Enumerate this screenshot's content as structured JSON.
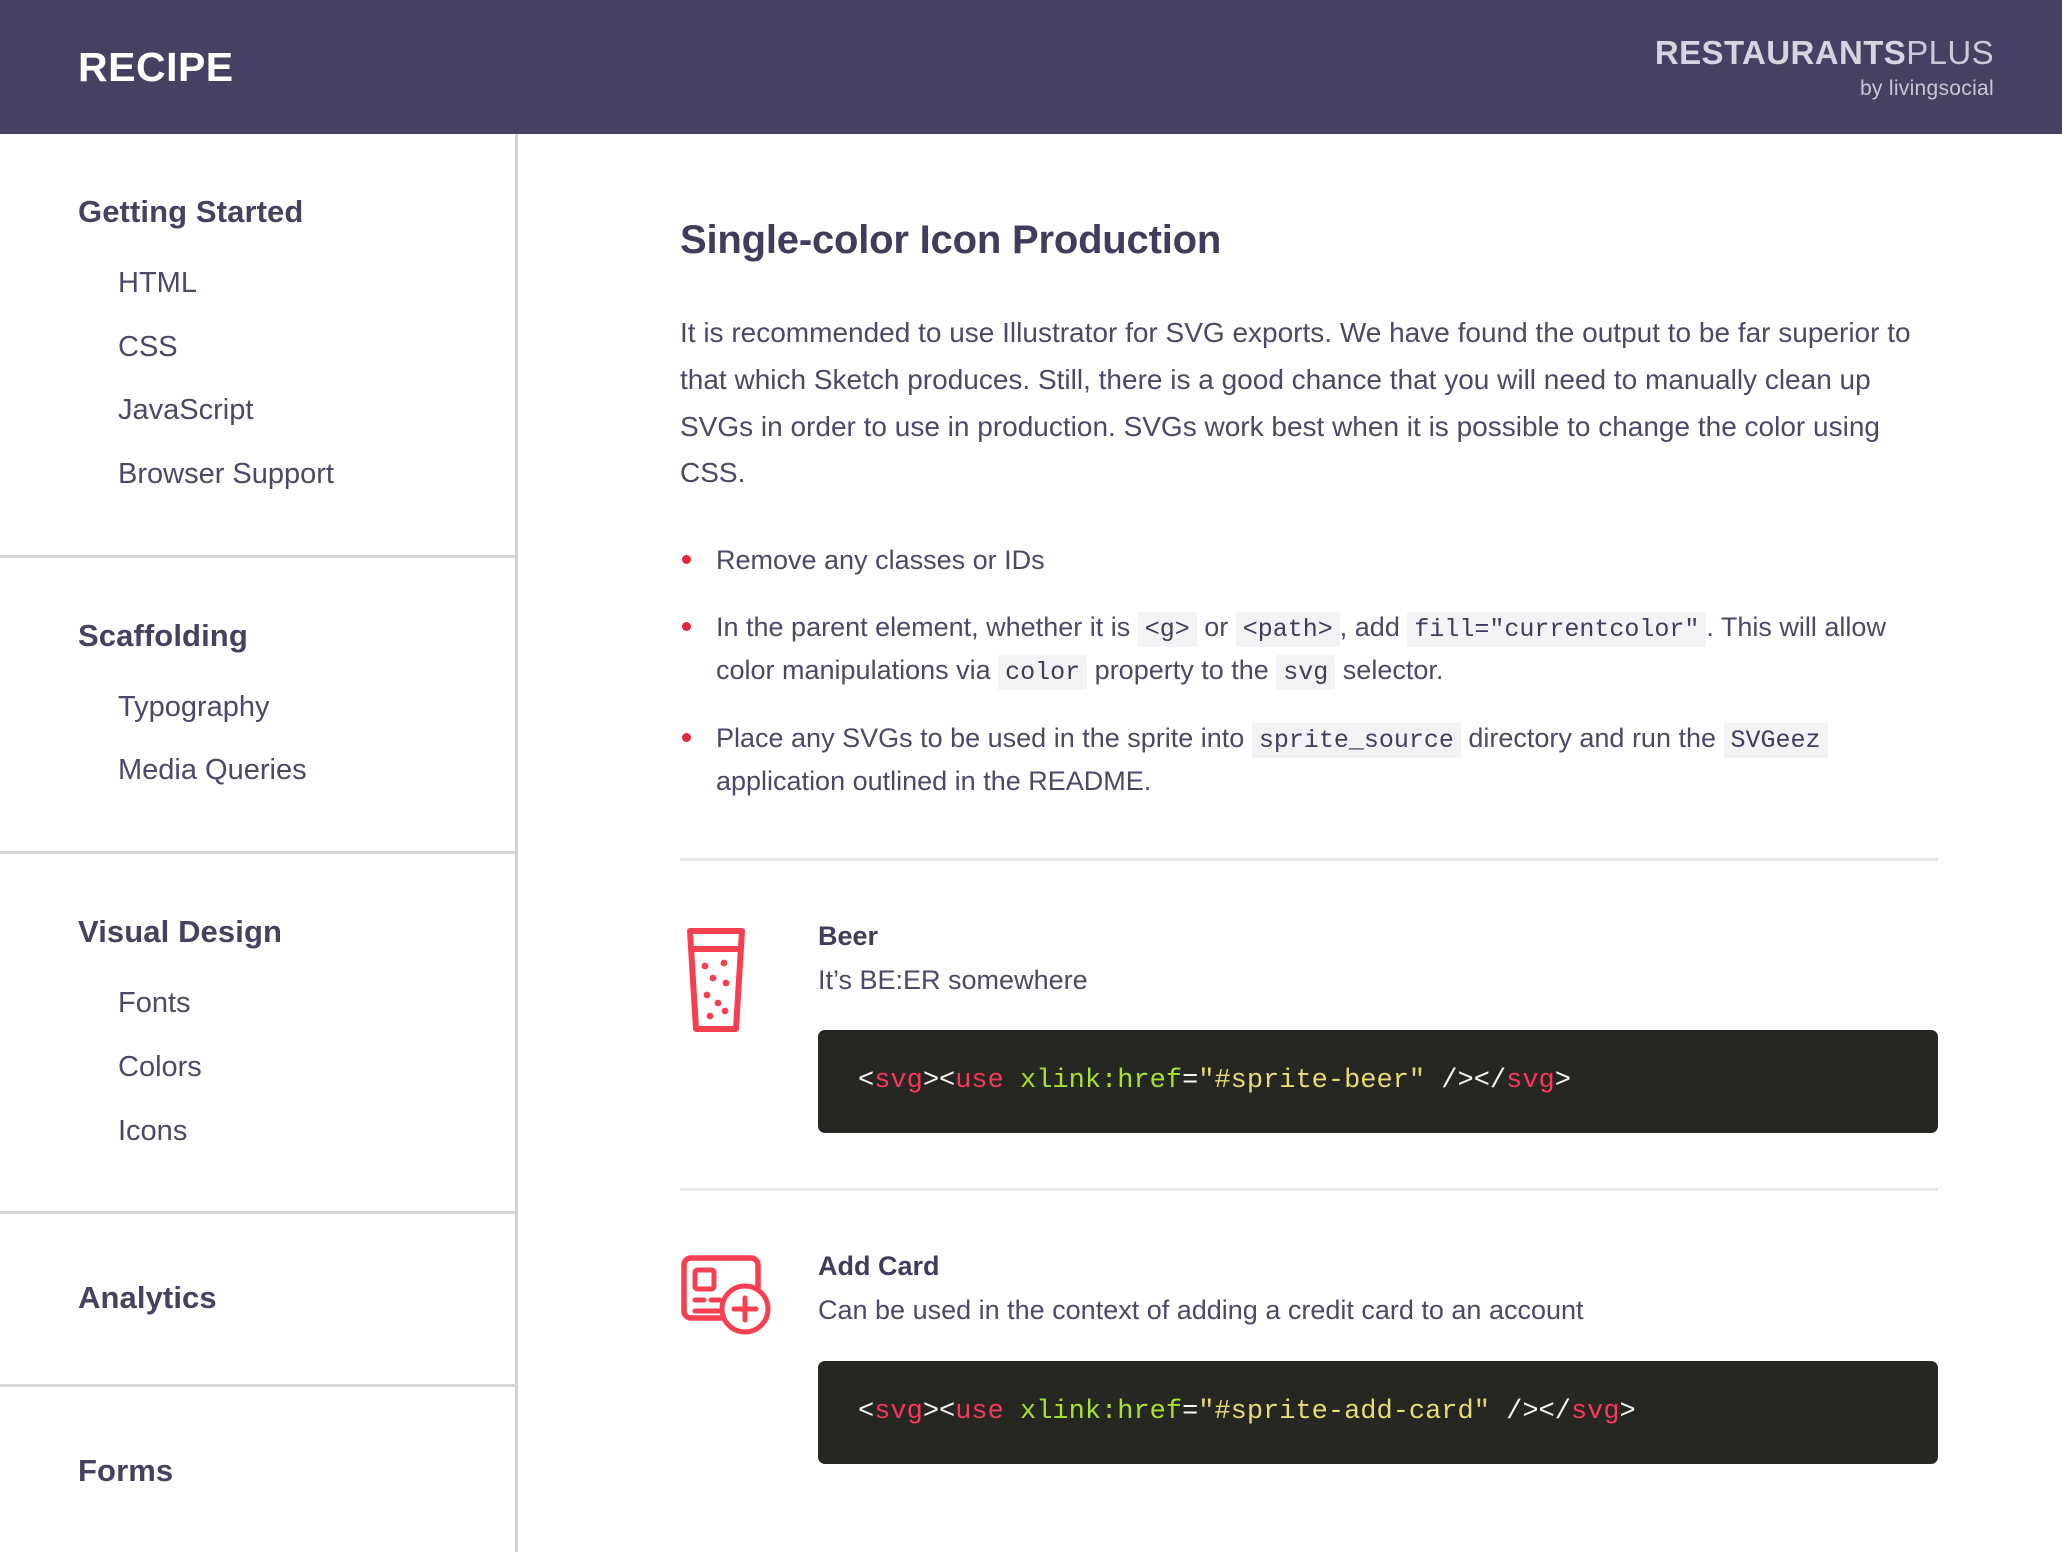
{
  "header": {
    "title": "RECIPE",
    "logo_bold": "RESTAURANTS",
    "logo_light": "PLUS",
    "logo_sub": "by livingsocial"
  },
  "sidebar": {
    "sections": [
      {
        "title": "Getting Started",
        "items": [
          {
            "label": "HTML"
          },
          {
            "label": "CSS"
          },
          {
            "label": "JavaScript"
          },
          {
            "label": "Browser Support"
          }
        ]
      },
      {
        "title": "Scaffolding",
        "items": [
          {
            "label": "Typography"
          },
          {
            "label": "Media Queries"
          }
        ]
      },
      {
        "title": "Visual Design",
        "items": [
          {
            "label": "Fonts"
          },
          {
            "label": "Colors"
          },
          {
            "label": "Icons"
          }
        ]
      },
      {
        "title": "Analytics",
        "items": []
      },
      {
        "title": "Forms",
        "items": []
      }
    ]
  },
  "main": {
    "title": "Single-color Icon Production",
    "intro": "It is recommended to use Illustrator for SVG exports. We have found the output to be far superior to that which Sketch produces. Still, there is a good chance that you will need to manually clean up SVGs in order to use in production. SVGs work best when it is possible to change the color using CSS.",
    "bullets": [
      {
        "parts": [
          {
            "type": "text",
            "value": "Remove any classes or IDs"
          }
        ]
      },
      {
        "parts": [
          {
            "type": "text",
            "value": "In the parent element, whether it is "
          },
          {
            "type": "code",
            "value": "<g>"
          },
          {
            "type": "text",
            "value": " or "
          },
          {
            "type": "code",
            "value": "<path>"
          },
          {
            "type": "text",
            "value": ", add "
          },
          {
            "type": "code",
            "value": "fill=\"currentcolor\""
          },
          {
            "type": "text",
            "value": ". This will allow color manipulations via "
          },
          {
            "type": "code",
            "value": "color"
          },
          {
            "type": "text",
            "value": " property to the "
          },
          {
            "type": "code",
            "value": "svg"
          },
          {
            "type": "text",
            "value": " selector."
          }
        ]
      },
      {
        "parts": [
          {
            "type": "text",
            "value": "Place any SVGs to be used in the sprite into "
          },
          {
            "type": "code",
            "value": "sprite_source"
          },
          {
            "type": "text",
            "value": " directory and run the "
          },
          {
            "type": "code",
            "value": "SVGeez"
          },
          {
            "type": "text",
            "value": " application outlined in the README."
          }
        ]
      }
    ],
    "icons": [
      {
        "icon": "beer-icon",
        "name": "Beer",
        "description": "It’s BE:ER somewhere",
        "snippet": {
          "sprite_id": "#sprite-beer",
          "tokens": [
            {
              "t": "punct",
              "v": "<"
            },
            {
              "t": "tag",
              "v": "svg"
            },
            {
              "t": "punct",
              "v": "><"
            },
            {
              "t": "tag",
              "v": "use"
            },
            {
              "t": "punct",
              "v": " "
            },
            {
              "t": "attr",
              "v": "xlink:href"
            },
            {
              "t": "punct",
              "v": "="
            },
            {
              "t": "str",
              "v": "\"#sprite-beer\""
            },
            {
              "t": "punct",
              "v": " /></"
            },
            {
              "t": "tag",
              "v": "svg"
            },
            {
              "t": "punct",
              "v": ">"
            }
          ]
        }
      },
      {
        "icon": "add-card-icon",
        "name": "Add Card",
        "description": "Can be used in the context of adding a credit card to an account",
        "snippet": {
          "sprite_id": "#sprite-add-card",
          "tokens": [
            {
              "t": "punct",
              "v": "<"
            },
            {
              "t": "tag",
              "v": "svg"
            },
            {
              "t": "punct",
              "v": "><"
            },
            {
              "t": "tag",
              "v": "use"
            },
            {
              "t": "punct",
              "v": " "
            },
            {
              "t": "attr",
              "v": "xlink:href"
            },
            {
              "t": "punct",
              "v": "="
            },
            {
              "t": "str",
              "v": "\"#sprite-add-card\""
            },
            {
              "t": "punct",
              "v": " /></"
            },
            {
              "t": "tag",
              "v": "svg"
            },
            {
              "t": "punct",
              "v": ">"
            }
          ]
        }
      }
    ]
  },
  "colors": {
    "header_bg": "#464162",
    "accent_red": "#f63f51",
    "bullet_red": "#e4253d",
    "text_purple": "#4c4868",
    "heading_purple": "#413c5c",
    "code_bg": "#262622"
  }
}
